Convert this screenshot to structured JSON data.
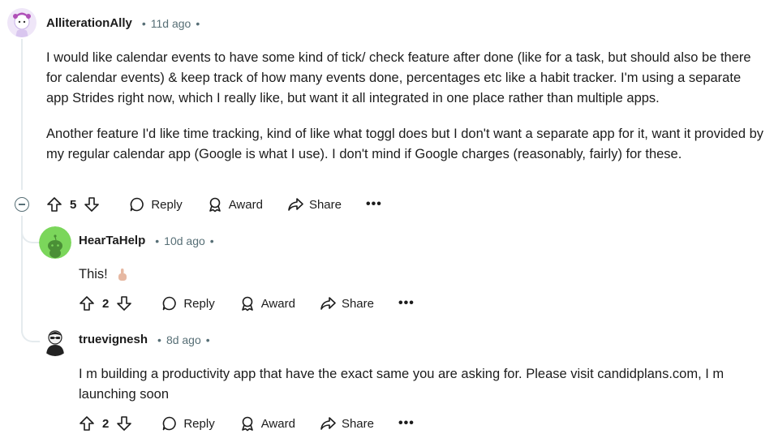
{
  "comments": [
    {
      "user": "AlliterationAlly",
      "time": "11d ago",
      "paragraphs": [
        "I would like calendar events to have some kind of tick/ check feature after done (like for a task, but should also be there for calendar events) & keep track of how many events done, percentages etc like a habit tracker. I'm using a separate app Strides right now, which I really like, but want it all integrated in one place rather than multiple apps.",
        "Another feature I'd like time tracking, kind of like what toggl does but I don't want a separate app for it, want it provided by my regular calendar app (Google is what I use). I don't mind if Google charges (reasonably, fairly) for these."
      ],
      "votes": "5"
    },
    {
      "user": "HearTaHelp",
      "time": "10d ago",
      "text": "This!",
      "votes": "2"
    },
    {
      "user": "truevignesh",
      "time": "8d ago",
      "text": "I m building a productivity app that have the exact same you are asking for. Please visit candidplans.com, I m launching soon",
      "votes": "2"
    }
  ],
  "labels": {
    "reply": "Reply",
    "award": "Award",
    "share": "Share",
    "more": "•••",
    "sep": "•"
  },
  "colors": {
    "meta": "#576f76",
    "thread_line": "#e5ebee",
    "avatar2_bg": "#7bd65b",
    "avatar1_bg": "#e9dcf7"
  }
}
